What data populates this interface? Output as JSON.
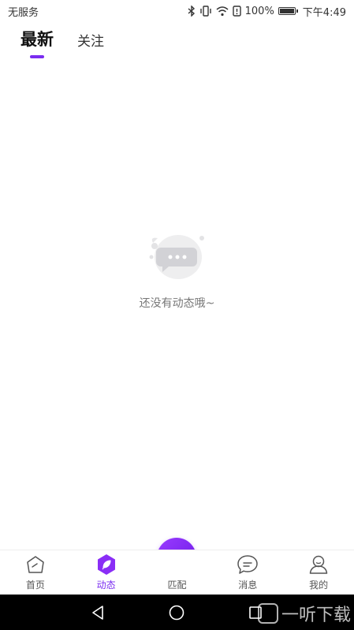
{
  "status_bar": {
    "carrier": "无服务",
    "battery": "100%",
    "time": "下午4:49"
  },
  "tabs": [
    {
      "label": "最新",
      "active": true
    },
    {
      "label": "关注",
      "active": false
    }
  ],
  "empty_state": {
    "message": "还没有动态哦~",
    "icon": "chat-bubble-icon"
  },
  "bottom_nav": {
    "items": [
      {
        "label": "首页",
        "icon": "home-icon",
        "active": false
      },
      {
        "label": "动态",
        "icon": "feather-icon",
        "active": true
      },
      {
        "label": "匹配",
        "icon": "hearts-icon",
        "active": false
      },
      {
        "label": "消息",
        "icon": "message-icon",
        "active": false
      },
      {
        "label": "我的",
        "icon": "profile-icon",
        "active": false
      }
    ]
  },
  "system_nav": {
    "watermark": "一听下载"
  },
  "colors": {
    "accent": "#7a2cf0",
    "text_muted": "#777777"
  }
}
